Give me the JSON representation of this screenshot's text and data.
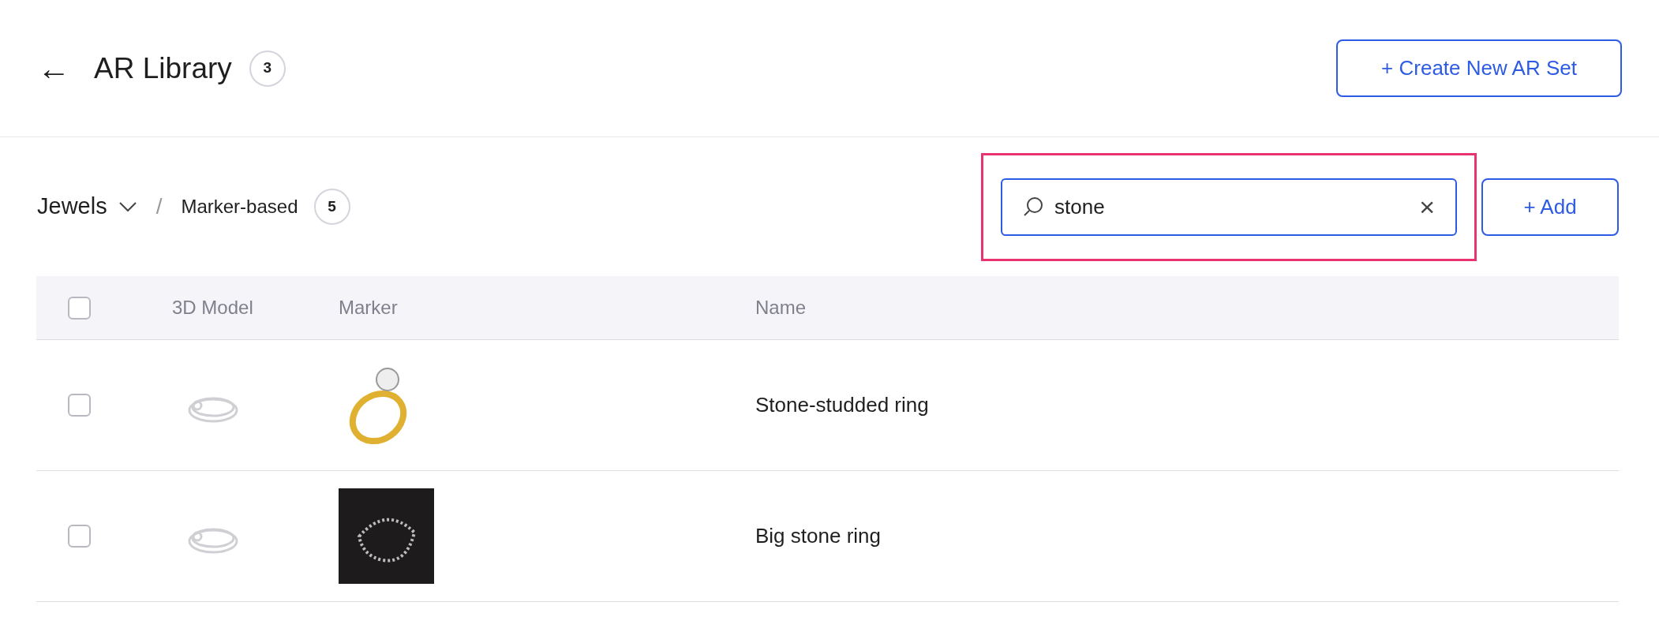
{
  "header": {
    "back_icon": "←",
    "title": "AR Library",
    "count": "3",
    "create_button": "+ Create New AR Set"
  },
  "breadcrumb": {
    "category": "Jewels",
    "separator": "/",
    "subcategory": "Marker-based",
    "count": "5"
  },
  "search": {
    "value": "stone",
    "clear": "×"
  },
  "add_button": "+ Add",
  "table": {
    "header_checked": false,
    "columns": [
      "3D Model",
      "Marker",
      "Name"
    ],
    "rows": [
      {
        "checked": false,
        "kind": "light",
        "name": "Stone-studded ring"
      },
      {
        "checked": false,
        "kind": "dark",
        "name": "Big stone ring"
      }
    ]
  }
}
